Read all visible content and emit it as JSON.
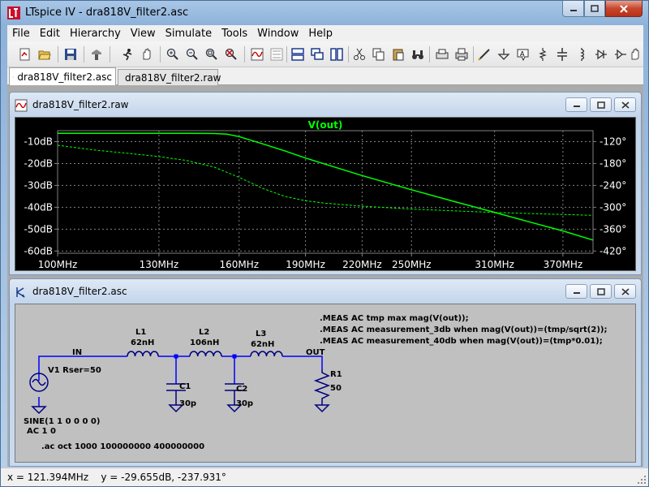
{
  "window": {
    "title": "LTspice IV - dra818V_filter2.asc",
    "controls": {
      "minimize": "minimize-icon",
      "maximize": "maximize-icon",
      "close": "close-icon"
    }
  },
  "menu": [
    "File",
    "Edit",
    "Hierarchy",
    "View",
    "Simulate",
    "Tools",
    "Window",
    "Help"
  ],
  "toolbar": {
    "icons": [
      "new-schematic-icon",
      "open-icon",
      "save-icon",
      "control-panel-icon",
      "run-icon",
      "halt-icon",
      "zoom-in-icon",
      "zoom-out-icon",
      "zoom-fit-icon",
      "zoom-cancel-icon",
      "waveform-icon",
      "dc-op-icon",
      "tile-horizontal-icon",
      "cascade-icon",
      "tile-vertical-icon",
      "cut-icon",
      "copy-icon",
      "paste-icon",
      "find-icon",
      "print-setup-icon",
      "print-icon",
      "draw-wire-icon",
      "ground-icon",
      "label-icon",
      "resistor-icon",
      "capacitor-icon",
      "inductor-icon",
      "diode-icon",
      "component-icon",
      "move-icon",
      "drag-icon"
    ]
  },
  "tabs": [
    {
      "label": "dra818V_filter2.asc",
      "icon": "schematic-icon",
      "active": true
    },
    {
      "label": "dra818V_filter2.raw",
      "icon": "waveform-icon",
      "active": false
    }
  ],
  "waveform_window": {
    "title": "dra818V_filter2.raw",
    "icon": "waveform-icon"
  },
  "schematic_window": {
    "title": "dra818V_filter2.asc",
    "icon": "schematic-icon",
    "directives": [
      ".MEAS AC tmp max mag(V(out));",
      ".MEAS AC measurement_3db when mag(V(out))=(tmp/sqrt(2));",
      ".MEAS AC measurement_40db when mag(V(out))=(tmp*0.01);"
    ],
    "components": {
      "L1": {
        "name": "L1",
        "value": "62nH"
      },
      "L2": {
        "name": "L2",
        "value": "106nH"
      },
      "L3": {
        "name": "L3",
        "value": "62nH"
      },
      "C1": {
        "name": "C1",
        "value": "30p"
      },
      "C2": {
        "name": "C2",
        "value": "30p"
      },
      "R1": {
        "name": "R1",
        "value": "50"
      },
      "V1": {
        "label": "V1 Rser=50",
        "source_line1": "SINE(1 1 0 0 0 0)",
        "source_line2": "AC 1 0"
      }
    },
    "net_labels": {
      "in": "IN",
      "out": "OUT"
    },
    "sim_command": ".ac oct 1000 100000000 400000000"
  },
  "status": {
    "text": "x = 121.394MHz    y = -29.655dB, -237.931°"
  },
  "colors": {
    "trace": "#00ff00",
    "plot_bg": "#000000",
    "grid": "#808080",
    "wire": "#0000ff",
    "component": "#000080",
    "schematic_bg": "#c0c0c0"
  },
  "chart_data": {
    "type": "line",
    "title": "V(out)",
    "x_scale": "log",
    "x_ticks": [
      "100MHz",
      "130MHz",
      "160MHz",
      "190MHz",
      "220MHz",
      "250MHz",
      "310MHz",
      "370MHz"
    ],
    "x_tick_values": [
      100,
      130,
      160,
      190,
      220,
      250,
      310,
      370
    ],
    "xlim": [
      100,
      400
    ],
    "y_left_ticks": [
      "-10dB",
      "-20dB",
      "-30dB",
      "-40dB",
      "-50dB",
      "-60dB"
    ],
    "y_left_values": [
      -10,
      -20,
      -30,
      -40,
      -50,
      -60
    ],
    "ylim_left": [
      -61,
      -5
    ],
    "y_right_ticks": [
      "-120°",
      "-180°",
      "-240°",
      "-300°",
      "-360°",
      "-420°"
    ],
    "y_right_values": [
      -120,
      -180,
      -240,
      -300,
      -360,
      -420
    ],
    "ylim_right": [
      -426,
      -90
    ],
    "grid": true,
    "series": [
      {
        "name": "V(out)",
        "axis": "left",
        "style": "solid",
        "x": [
          100,
          110,
          120,
          130,
          140,
          150,
          155,
          160,
          170,
          180,
          190,
          200,
          220,
          250,
          280,
          310,
          340,
          370,
          400
        ],
        "y": [
          -6.2,
          -6.2,
          -6.2,
          -6.2,
          -6.2,
          -6.3,
          -6.6,
          -7.7,
          -11,
          -14.2,
          -17.5,
          -20.3,
          -25.5,
          -32,
          -37.5,
          -42.3,
          -46.8,
          -50.8,
          -55
        ]
      },
      {
        "name": "phase",
        "axis": "right",
        "style": "dashed",
        "x": [
          100,
          110,
          120,
          130,
          140,
          150,
          160,
          170,
          180,
          190,
          200,
          220,
          250,
          300,
          350,
          400
        ],
        "y": [
          -130,
          -143,
          -152,
          -161,
          -172,
          -190,
          -218,
          -248,
          -270,
          -282,
          -289,
          -297,
          -305,
          -313,
          -318,
          -322
        ]
      }
    ]
  }
}
